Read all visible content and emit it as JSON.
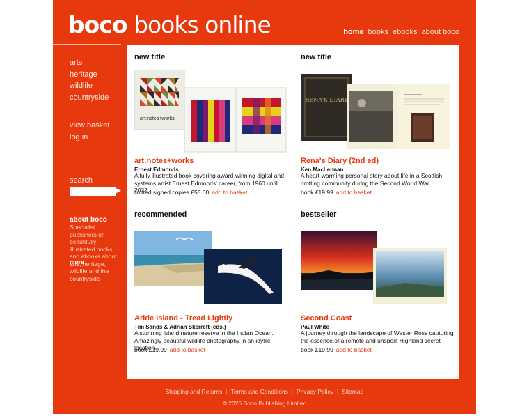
{
  "site": {
    "logo_bold": "boco",
    "logo_light": " books online",
    "nav": [
      "home",
      "books",
      "ebooks",
      "about boco"
    ]
  },
  "sidebar": {
    "categories": [
      "arts",
      "heritage",
      "wildlife",
      "countryside"
    ],
    "account": [
      "view basket",
      "log in"
    ],
    "search_label": "search",
    "search_value": "",
    "search_go": "▶",
    "about_title": "about boco",
    "about_text": "Specialist publishers of beautifully-illustrated books and ebooks about arts, heritage, wildlife and the countryside",
    "about_more": "more"
  },
  "books": [
    {
      "label": "new title",
      "title": "art:notes+works",
      "author": "Ernest Edmonds",
      "desc": "A fully illustrated book covering award-winning digital and systems artist Ernest Edmonds' career, from 1960 until 2022",
      "price": "limited signed copies £55.00",
      "add": "add to basket",
      "cover_text": "art:notes+works"
    },
    {
      "label": "new title",
      "title": "Rena's Diary (2nd ed)",
      "author": "Ken MacLennan",
      "desc": "A heart-warming personal story about life in a Scottish crofting community during the Second World War",
      "price": "book £19.99",
      "add": "add to basket",
      "cover_text": "RENA'S DIARY"
    },
    {
      "label": "recommended",
      "title": "Aride Island - Tread Lightly",
      "author": "Tim Sands & Adrian Skerrett (eds.)",
      "desc": "A stunning island nature reserve in the Indian Ocean. Amazingly beautiful wildlife photography in an idyllic location",
      "price": "book £19.99",
      "add": "add to basket"
    },
    {
      "label": "bestseller",
      "title": "Second Coast",
      "author": "Paul White",
      "desc": "A journey through the landscape of Wester Ross capturing the essence of a remote and unspoilt Highland secret",
      "price": "book £19.99",
      "add": "add to basket"
    }
  ],
  "footer": {
    "links": [
      "Shipping and Returns",
      "Terms and Conditions",
      "Privacy Policy",
      "Sitemap"
    ],
    "copyright": "© 2025 Boco Publishing Limited"
  }
}
